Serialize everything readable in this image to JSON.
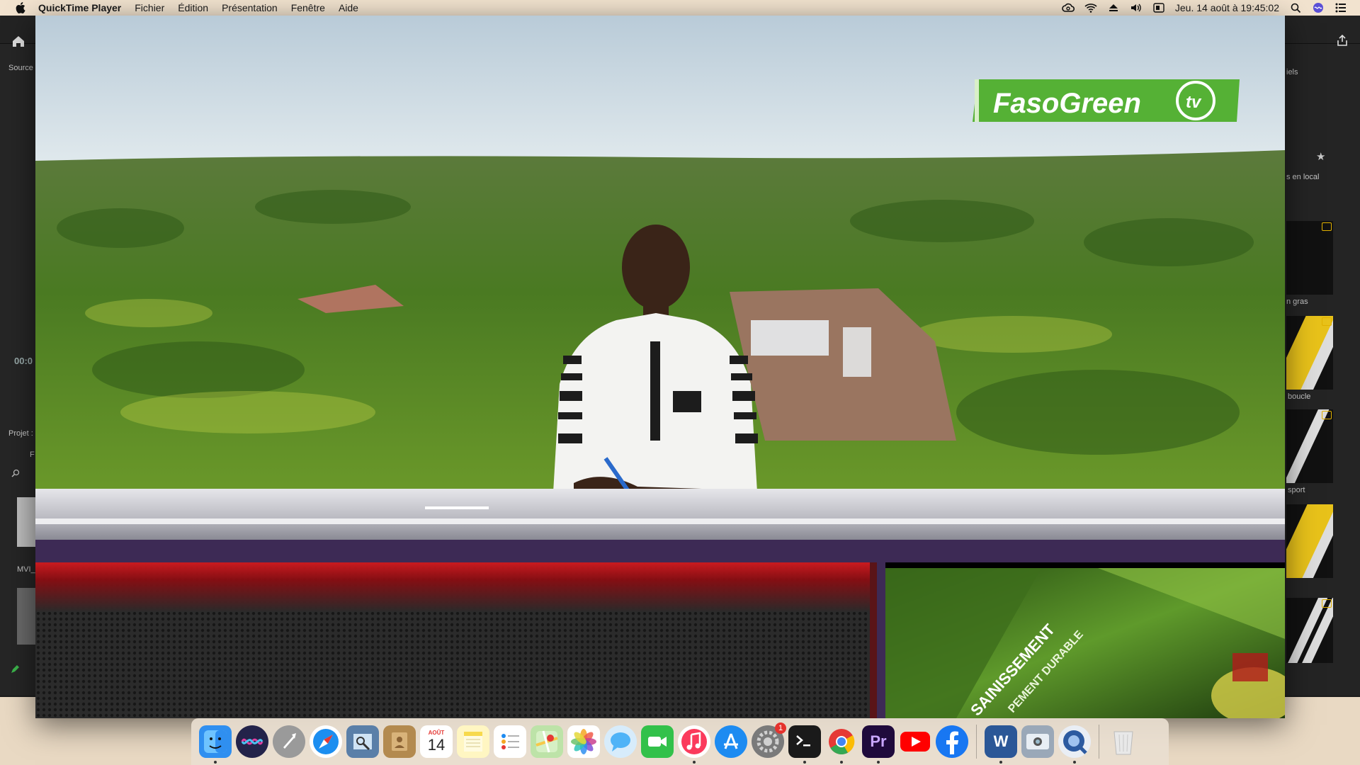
{
  "menubar": {
    "app_name": "QuickTime Player",
    "menus": [
      "Fichier",
      "Édition",
      "Présentation",
      "Fenêtre",
      "Aide"
    ],
    "clock": "Jeu. 14 août à 19:45:02"
  },
  "background_app": {
    "source_tab": "Source",
    "timecode": "00:0",
    "project_tab": "Projet :",
    "project_f": "F",
    "clip_label": "MVI_",
    "right_labels": [
      "iels",
      "s en local",
      "n gras",
      "boucle",
      "sport"
    ]
  },
  "video": {
    "logo_text": "FasoGreen",
    "logo_badge": "tv",
    "inset_text_1": "SAINISSEMENT",
    "inset_text_2": "PEMENT DURABLE",
    "colors": {
      "logo_green": "#55b135",
      "desk_purple": "#3d2a55",
      "lower_red": "#c8141c"
    }
  },
  "dock": {
    "items": [
      {
        "name": "finder-icon",
        "color": "#2f8ff0"
      },
      {
        "name": "siri-icon",
        "color": "#2a2a55"
      },
      {
        "name": "launchpad-icon",
        "color": "#8a8a8a"
      },
      {
        "name": "safari-icon",
        "color": "#1c8ef0"
      },
      {
        "name": "preview-icon",
        "color": "#5a7fa8"
      },
      {
        "name": "contacts-icon",
        "color": "#b38a4f"
      },
      {
        "name": "calendar-icon",
        "color": "#ffffff"
      },
      {
        "name": "notes-icon",
        "color": "#f7e27a"
      },
      {
        "name": "reminders-icon",
        "color": "#ffffff"
      },
      {
        "name": "maps-icon",
        "color": "#6cc26b"
      },
      {
        "name": "photos-icon",
        "color": "#ffffff"
      },
      {
        "name": "messages-icon",
        "color": "#4fb3f7"
      },
      {
        "name": "facetime-icon",
        "color": "#32c14a"
      },
      {
        "name": "music-icon",
        "color": "#fb3a5c"
      },
      {
        "name": "appstore-icon",
        "color": "#1d8bf1"
      },
      {
        "name": "system-preferences-icon",
        "color": "#7a7a7a"
      },
      {
        "name": "terminal-icon",
        "color": "#1a1a1a"
      },
      {
        "name": "chrome-icon",
        "color": "#ffffff"
      },
      {
        "name": "premiere-icon",
        "color": "#1f0a3c"
      },
      {
        "name": "youtube-icon",
        "color": "#ff0000"
      },
      {
        "name": "facebook-icon",
        "color": "#1877f2"
      },
      {
        "name": "word-icon",
        "color": "#2b5797"
      },
      {
        "name": "screenshot-icon",
        "color": "#9aa8b8"
      },
      {
        "name": "quicktime-icon",
        "color": "#2c5aa0"
      },
      {
        "name": "trash-icon",
        "color": "#d8d8d8"
      }
    ],
    "calendar_month": "AOÛT",
    "calendar_day": "14",
    "sysprefs_badge": "1",
    "premiere_label": "Pr",
    "word_label": "W"
  }
}
